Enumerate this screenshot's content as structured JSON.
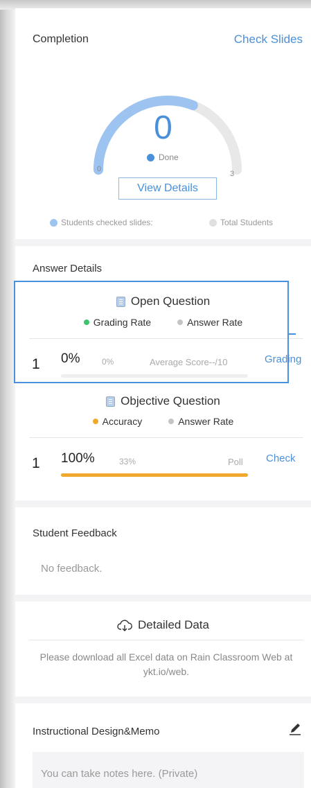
{
  "completion": {
    "title": "Completion",
    "check_slides": "Check Slides",
    "value": "0",
    "done_label": "Done",
    "min": "0",
    "max": "3",
    "progress_fraction": 0.62,
    "view_details": "View Details",
    "legend_checked": "Students checked slides:",
    "legend_total": "Total Students",
    "colors": {
      "progress": "#9dc3f0",
      "track": "#e8e8e8",
      "accent": "#4a90d9"
    }
  },
  "answer_details": {
    "title": "Answer Details",
    "open_question": {
      "heading": "Open Question",
      "legend_primary": "Grading Rate",
      "legend_secondary": "Answer Rate",
      "row": {
        "index": "1",
        "percent": "0%",
        "sub_percent": "0%",
        "right_text": "Average Score--/10",
        "action": "Grading",
        "fill_fraction": 0.0
      }
    },
    "objective_question": {
      "heading": "Objective Question",
      "legend_primary": "Accuracy",
      "legend_secondary": "Answer Rate",
      "row": {
        "index": "1",
        "percent": "100%",
        "sub_percent": "33%",
        "right_text": "Poll",
        "action": "Check",
        "fill_fraction": 1.0
      }
    },
    "colors": {
      "grading": "#3cc36b",
      "answer": "#c4c4c4",
      "accuracy": "#f0a92e",
      "link": "#4a90d9"
    }
  },
  "feedback": {
    "title": "Student Feedback",
    "empty_text": "No feedback."
  },
  "detailed_data": {
    "title": "Detailed Data",
    "icon": "cloud-download-icon",
    "note": "Please download all Excel data on Rain Classroom Web at ykt.io/web."
  },
  "memo": {
    "title": "Instructional Design&Memo",
    "icon": "pencil-icon",
    "placeholder": "You can take notes here. (Private)"
  }
}
